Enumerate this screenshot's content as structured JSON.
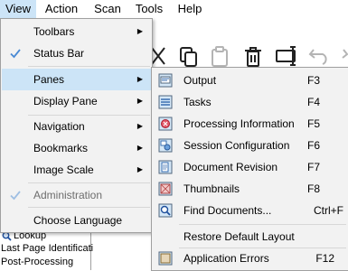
{
  "menubar": {
    "view": "View",
    "action": "Action",
    "scan": "Scan",
    "tools": "Tools",
    "help": "Help"
  },
  "background": {
    "rows": [
      "Lookup",
      "Last Page Identificati",
      "Post-Processing"
    ]
  },
  "view_menu": {
    "toolbars": "Toolbars",
    "status_bar": "Status Bar",
    "panes": "Panes",
    "display_pane": "Display Pane",
    "navigation": "Navigation",
    "bookmarks": "Bookmarks",
    "image_scale": "Image Scale",
    "administration": "Administration",
    "choose_language": "Choose Language"
  },
  "panes_menu": {
    "output": "Output",
    "output_key": "F3",
    "tasks": "Tasks",
    "tasks_key": "F4",
    "processing": "Processing Information",
    "processing_key": "F5",
    "session": "Session Configuration",
    "session_key": "F6",
    "revision": "Document Revision",
    "revision_key": "F7",
    "thumbnails": "Thumbnails",
    "thumbnails_key": "F8",
    "find": "Find Documents...",
    "find_key": "Ctrl+F",
    "restore": "Restore Default Layout",
    "app_errors": "Application Errors",
    "app_errors_key": "F12"
  },
  "colors": {
    "highlight": "#cce4f7",
    "menu_bg": "#f2f2f2",
    "check_blue": "#4a8ad4"
  }
}
